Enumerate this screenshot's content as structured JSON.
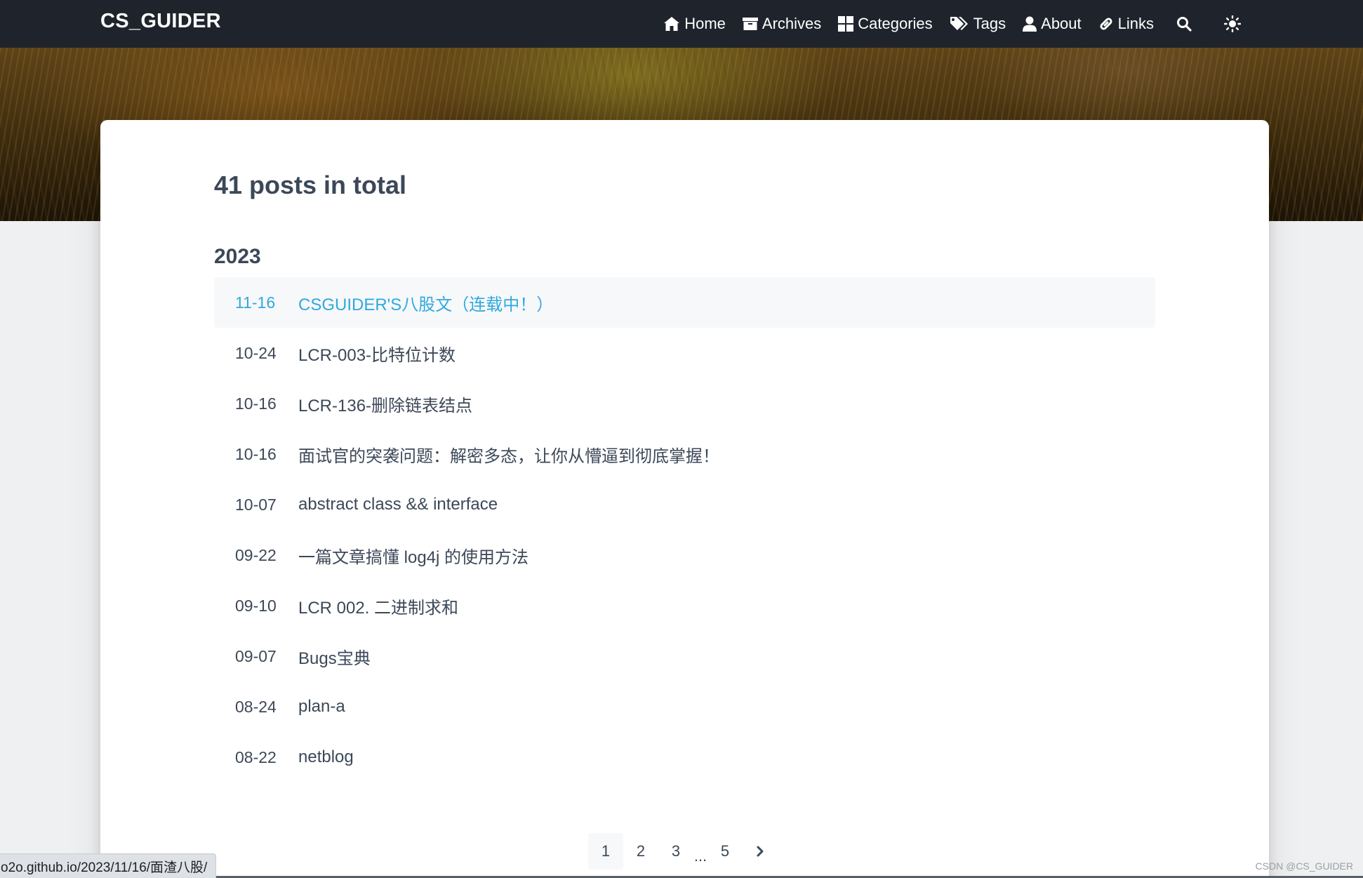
{
  "navbar": {
    "brand": "CS_GUIDER",
    "items": [
      {
        "label": "Home",
        "icon": "home-icon"
      },
      {
        "label": "Archives",
        "icon": "archive-icon"
      },
      {
        "label": "Categories",
        "icon": "categories-icon"
      },
      {
        "label": "Tags",
        "icon": "tags-icon"
      },
      {
        "label": "About",
        "icon": "user-icon"
      },
      {
        "label": "Links",
        "icon": "link-icon"
      }
    ],
    "search_icon": "search-icon",
    "theme_icon": "sun-icon"
  },
  "archive": {
    "title": "41 posts in total",
    "year": "2023",
    "posts": [
      {
        "date": "11-16",
        "title": "CSGUIDER'S八股文（连载中！）"
      },
      {
        "date": "10-24",
        "title": "LCR-003-比特位计数"
      },
      {
        "date": "10-16",
        "title": "LCR-136-删除链表结点"
      },
      {
        "date": "10-16",
        "title": "面试官的突袭问题：解密多态，让你从懵逼到彻底掌握！"
      },
      {
        "date": "10-07",
        "title": "abstract class && interface"
      },
      {
        "date": "09-22",
        "title": "一篇文章搞懂 log4j 的使用方法"
      },
      {
        "date": "09-10",
        "title": "LCR 002. 二进制求和"
      },
      {
        "date": "09-07",
        "title": "Bugs宝典"
      },
      {
        "date": "08-24",
        "title": "plan-a"
      },
      {
        "date": "08-22",
        "title": "netblog"
      }
    ]
  },
  "pagination": {
    "pages": [
      "1",
      "2",
      "3"
    ],
    "ellipsis": "...",
    "last": "5",
    "next_icon": "chevron-right-icon"
  },
  "status_bar": {
    "url": "o2o.github.io/2023/11/16/面渣八股/"
  },
  "watermark": "CSDN @CS_GUIDER",
  "colors": {
    "navbar": "#1f232c",
    "link_active": "#30a9de",
    "text": "#3c4858"
  }
}
